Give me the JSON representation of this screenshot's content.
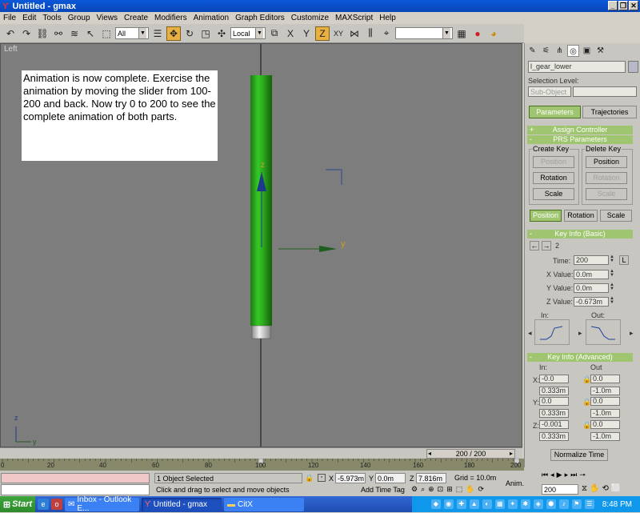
{
  "window": {
    "title": "Untitled - gmax",
    "buttons": [
      "_",
      "❐",
      "✕"
    ]
  },
  "menu": [
    "File",
    "Edit",
    "Tools",
    "Group",
    "Views",
    "Create",
    "Modifiers",
    "Animation",
    "Graph Editors",
    "Customize",
    "MAXScript",
    "Help"
  ],
  "toolbar": {
    "selection_filter": "All",
    "coord_system": "Local",
    "axis_buttons": [
      "X",
      "Y",
      "Z",
      "XY"
    ],
    "named_selection": ""
  },
  "viewport": {
    "label": "Left",
    "note": "Animation is now complete. Exercise the animation by moving the slider from 100-200 and back. Now try 0 to 200 to see the complete animation of both parts.",
    "axis_z": "z",
    "axis_y": "y",
    "corner_z": "z",
    "corner_y": "y"
  },
  "panel": {
    "object_name": "l_gear_lower",
    "selection_level_label": "Selection Level:",
    "sub_object": "Sub-Object",
    "tab_parameters": "Parameters",
    "tab_trajectories": "Trajectories",
    "assign_controller": "Assign Controller",
    "prs_parameters": "PRS Parameters",
    "create_key": "Create Key",
    "delete_key": "Delete Key",
    "position": "Position",
    "rotation": "Rotation",
    "scale": "Scale",
    "key_info_basic": "Key Info (Basic)",
    "key_number": "2",
    "time_label": "Time:",
    "time_value": "200",
    "lock": "L",
    "x_label": "X Value:",
    "x_value": "0.0m",
    "y_label": "Y Value:",
    "y_value": "0.0m",
    "z_label": "Z Value:",
    "z_value": "-0.673m",
    "in_label": "In:",
    "out_label": "Out:",
    "key_info_advanced": "Key Info (Advanced)",
    "adv_in": "In:",
    "adv_out": "Out",
    "adv_x_in": "-0.0",
    "adv_x_in2": "0.333m",
    "adv_x_out": "0.0",
    "adv_x_out2": "-1.0m",
    "adv_y_in": "0.0",
    "adv_y_in2": "0.333m",
    "adv_y_out": "0.0",
    "adv_y_out2": "-1.0m",
    "adv_z_in": "-0.001",
    "adv_z_in2": "0.333m",
    "adv_z_out": "0.0",
    "adv_z_out2": "-1.0m",
    "normalize_time": "Normalize Time"
  },
  "timeline": {
    "frame": "200 / 200",
    "ticks": [
      "0",
      "20",
      "40",
      "60",
      "80",
      "100",
      "120",
      "140",
      "160",
      "180",
      "200"
    ]
  },
  "status": {
    "selected": "1 Object Selected",
    "prompt": "Click and drag to select and move objects",
    "x": "-5.973m",
    "y": "0.0m",
    "z": "7.816m",
    "grid": "Grid = 10.0m",
    "add_time_tag": "Add Time Tag",
    "anim": "Anim.",
    "frame_field": "200"
  },
  "taskbar": {
    "start": "Start",
    "tasks": [
      "Inbox - Outlook E...",
      "Untitled - gmax",
      "CitX"
    ],
    "clock": "8:48 PM"
  }
}
